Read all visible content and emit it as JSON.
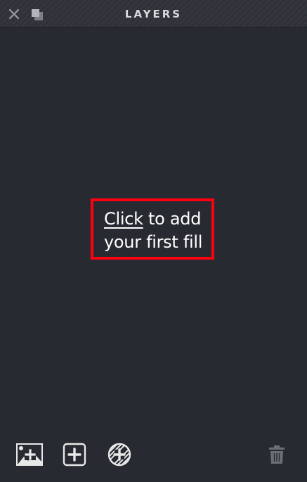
{
  "header": {
    "title": "LAYERS",
    "close_icon": "close-icon",
    "detach_icon": "detach-panel-icon"
  },
  "empty_state": {
    "link_text": "Click",
    "rest_line1": " to add",
    "line2": "your first fill"
  },
  "toolbar": {
    "buttons": [
      {
        "icon": "add-image-fill-icon"
      },
      {
        "icon": "add-color-fill-icon"
      },
      {
        "icon": "add-pattern-fill-icon"
      },
      {
        "icon": "trash-icon"
      }
    ]
  },
  "colors": {
    "background": "#272a31",
    "header": "#303239",
    "text": "#ffffff",
    "highlight": "#ff0010",
    "icon": "#e8e8e8",
    "icon_disabled": "#6b6e75"
  }
}
